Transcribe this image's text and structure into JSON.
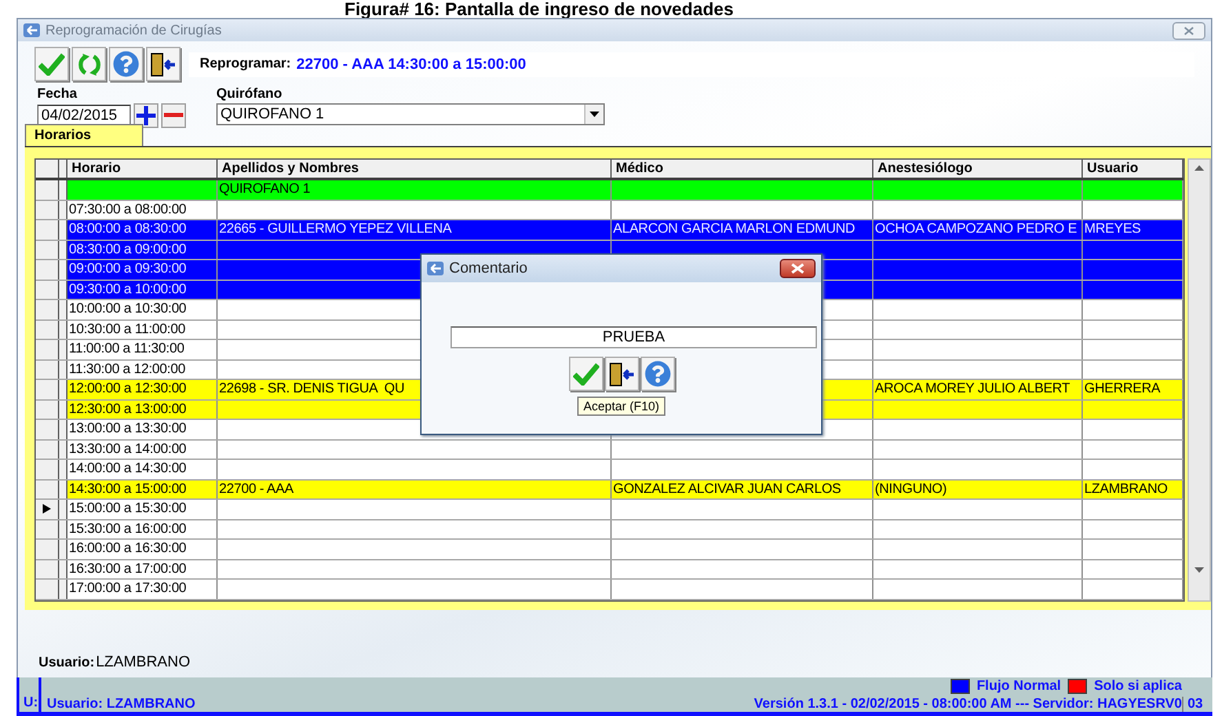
{
  "caption": "Figura# 16: Pantalla de ingreso de novedades",
  "window": {
    "title": "Reprogramación de Cirugías"
  },
  "toolbar": {
    "buttons": [
      {
        "kind": "check"
      },
      {
        "kind": "refresh"
      },
      {
        "kind": "help"
      },
      {
        "kind": "exit"
      }
    ],
    "reschedule": {
      "label": "Reprogramar:",
      "value": "22700 - AAA 14:30:00 a 15:00:00"
    }
  },
  "date": {
    "label": "Fecha",
    "value": "04/02/2015"
  },
  "room": {
    "label": "Quirófano",
    "value": "QUIROFANO 1"
  },
  "tabs": [
    {
      "label": "Horarios",
      "selected": true
    }
  ],
  "table": {
    "columns": [
      "Horario",
      "Apellidos y Nombres",
      "Médico",
      "Anestesiólogo",
      "Usuario"
    ],
    "rows": [
      {
        "patient": "QUIROFANO 1",
        "color": "#00ff00",
        "selected": false
      },
      {
        "time": "07:30:00 a 08:00:00",
        "color": "#ffffff",
        "selected": false
      },
      {
        "time": "08:00:00 a 08:30:00",
        "patient": "22665 - GUILLERMO YEPEZ VILLENA",
        "doctor": "ALARCON GARCIA MARLON EDMUND",
        "anesthetist": "OCHOA CAMPOZANO PEDRO E",
        "user": "MREYES",
        "color": "#0000ff",
        "selected": false
      },
      {
        "time": "08:30:00 a 09:00:00",
        "color": "#0000ff",
        "selected": false
      },
      {
        "time": "09:00:00 a 09:30:00",
        "color": "#0000ff",
        "selected": false
      },
      {
        "time": "09:30:00 a 10:00:00",
        "color": "#0000ff",
        "selected": false
      },
      {
        "time": "10:00:00 a 10:30:00",
        "color": "#ffffff",
        "selected": false
      },
      {
        "time": "10:30:00 a 11:00:00",
        "color": "#ffffff",
        "selected": false
      },
      {
        "time": "11:00:00 a 11:30:00",
        "color": "#ffffff",
        "selected": false
      },
      {
        "time": "11:30:00 a 12:00:00",
        "color": "#ffffff",
        "selected": false
      },
      {
        "time": "12:00:00 a 12:30:00",
        "patient": "22698 - SR. DENIS TIGUA  QU",
        "anesthetist": "AROCA MOREY JULIO ALBERT",
        "user": "GHERRERA",
        "color": "#ffff00",
        "selected": false
      },
      {
        "time": "12:30:00 a 13:00:00",
        "color": "#ffff00",
        "selected": false
      },
      {
        "time": "13:00:00 a 13:30:00",
        "color": "#ffffff",
        "selected": false
      },
      {
        "time": "13:30:00 a 14:00:00",
        "color": "#ffffff",
        "selected": false
      },
      {
        "time": "14:00:00 a 14:30:00",
        "color": "#ffffff",
        "selected": false
      },
      {
        "time": "14:30:00 a 15:00:00",
        "patient": "22700 - AAA",
        "doctor": "GONZALEZ ALCIVAR JUAN CARLOS",
        "anesthetist": "(NINGUNO)",
        "user": "LZAMBRANO",
        "color": "#ffff00",
        "selected": false
      },
      {
        "time": "15:00:00 a 15:30:00",
        "color": "#ffffff",
        "selected": true
      },
      {
        "time": "15:30:00 a 16:00:00",
        "color": "#ffffff",
        "selected": false
      },
      {
        "time": "16:00:00 a 16:30:00",
        "color": "#ffffff",
        "selected": false
      },
      {
        "time": "16:30:00 a 17:00:00",
        "color": "#ffffff",
        "selected": false
      },
      {
        "time": "17:00:00 a 17:30:00",
        "color": "#ffffff",
        "selected": false
      }
    ]
  },
  "dialog": {
    "title": "Comentario",
    "value": "PRUEBA",
    "buttons": [
      {
        "kind": "check"
      },
      {
        "kind": "exit"
      },
      {
        "kind": "help"
      }
    ],
    "tooltip": "Aceptar (F10)"
  },
  "footer": {
    "user_label": "Usuario:",
    "user_value": "LZAMBRANO"
  },
  "status_bar": {
    "panel_1": "U:",
    "user": "Usuario: LZAMBRANO",
    "legend": [
      {
        "label": "Flujo Normal",
        "color": "#0000ff"
      },
      {
        "label": "Solo si aplica",
        "color": "#ff0000"
      }
    ],
    "version": "Versión 1.3.1 - 02/02/2015 - 08:00:00 AM --- Servidor: HAGYESRV0",
    "panel_3": "03"
  }
}
